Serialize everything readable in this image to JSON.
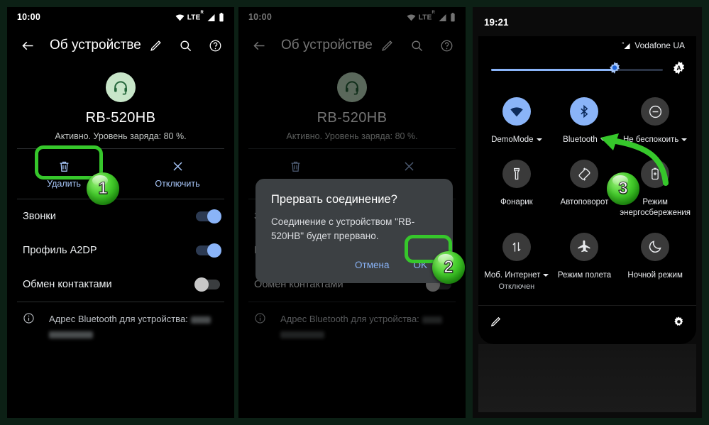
{
  "theme": {
    "accent_green": "#36c72b",
    "accent_blue": "#8ab4f8",
    "panel_bg": "#000000",
    "dialog_bg": "#3c4043",
    "border_green": "#0c2015"
  },
  "panel1": {
    "status_bar": {
      "clock": "10:00",
      "network": "LTE",
      "roaming": "R"
    },
    "appbar": {
      "title": "Об устройстве",
      "back": "back-arrow",
      "edit": "pencil",
      "search": "search",
      "help": "help"
    },
    "device": {
      "name": "RB-520HB",
      "status": "Активно. Уровень заряда: 80 %."
    },
    "actions": [
      {
        "label": "Удалить",
        "icon": "trash-icon"
      },
      {
        "label": "Отключить",
        "icon": "close-icon"
      }
    ],
    "settings": [
      {
        "label": "Звонки",
        "state": "on"
      },
      {
        "label": "Профиль A2DP",
        "state": "on"
      },
      {
        "label": "Обмен контактами",
        "state": "off"
      }
    ],
    "bt_address_label": "Адрес Bluetooth для устройства:"
  },
  "panel2": {
    "status_bar": {
      "clock": "10:00",
      "network": "LTE",
      "roaming": "R"
    },
    "appbar": {
      "title": "Об устройстве"
    },
    "device": {
      "name": "RB-520HB",
      "status": "Активно. Уровень заряда: 80 %."
    },
    "actions": [
      {
        "label": "Удалить",
        "icon": "trash-icon"
      },
      {
        "label": "Отключить",
        "icon": "close-icon"
      }
    ],
    "settings": [
      {
        "label": "Звонки",
        "state": "on"
      },
      {
        "label": "Профиль A2DP",
        "state": "on"
      },
      {
        "label": "Обмен контактами",
        "state": "off"
      }
    ],
    "bt_address_label": "Адрес Bluetooth для устройства:",
    "dialog": {
      "title": "Прервать соединение?",
      "message": "Соединение с устройством \"RB-520HB\" будет прервано.",
      "cancel_label": "Отмена",
      "ok_label": "OK"
    }
  },
  "panel3": {
    "clock": "19:21",
    "carrier": "Vodafone UA",
    "brightness": {
      "value_percent": 72,
      "auto_label": "A"
    },
    "tiles": [
      {
        "label": "DemoMode",
        "icon": "wifi-icon",
        "active": true,
        "has_caret": true,
        "sub": ""
      },
      {
        "label": "Bluetooth",
        "icon": "bluetooth-icon",
        "active": true,
        "has_caret": true,
        "sub": ""
      },
      {
        "label": "Не беспокоить",
        "icon": "dnd-icon",
        "active": false,
        "has_caret": true,
        "sub": ""
      },
      {
        "label": "Фонарик",
        "icon": "flashlight-icon",
        "active": false,
        "has_caret": false,
        "sub": ""
      },
      {
        "label": "Автоповорот",
        "icon": "autorotate-icon",
        "active": false,
        "has_caret": false,
        "sub": ""
      },
      {
        "label": "Режим энергосбережения",
        "icon": "battery-saver-icon",
        "active": false,
        "has_caret": false,
        "sub": ""
      },
      {
        "label": "Моб. Интернет",
        "icon": "mobile-data-icon",
        "active": false,
        "has_caret": true,
        "sub": "Отключен"
      },
      {
        "label": "Режим полета",
        "icon": "airplane-icon",
        "active": false,
        "has_caret": false,
        "sub": ""
      },
      {
        "label": "Ночной режим",
        "icon": "night-mode-icon",
        "active": false,
        "has_caret": false,
        "sub": ""
      }
    ],
    "footer": {
      "edit": "pencil-icon",
      "settings": "gear-icon"
    }
  },
  "annotations": {
    "step1": "1",
    "step2": "2",
    "step3": "3"
  }
}
